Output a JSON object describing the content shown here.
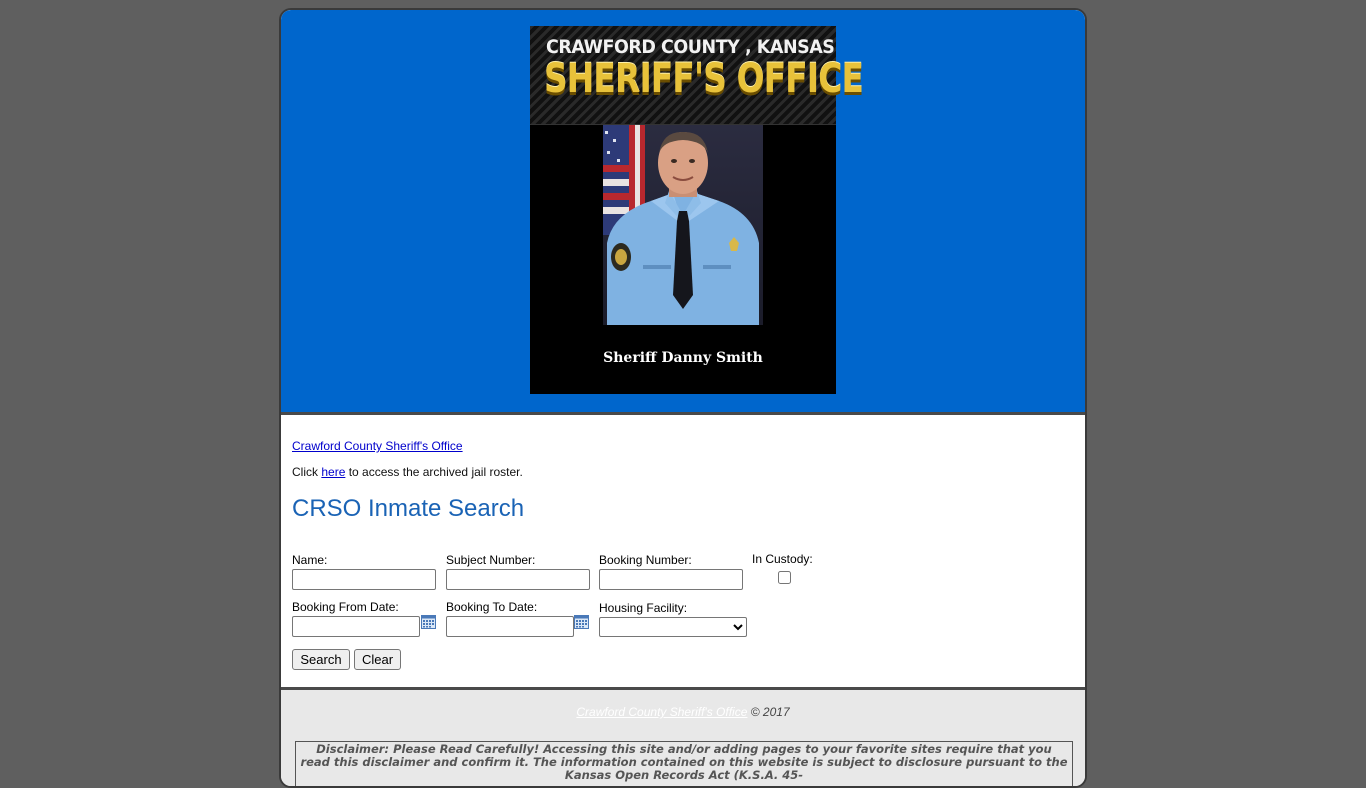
{
  "banner": {
    "logo_county": "CRAWFORD COUNTY , KANSAS",
    "logo_office": "SHERIFF'S OFFICE",
    "logo_caption": "Sheriff Danny Smith",
    "background_color": "#0066cc"
  },
  "content": {
    "top_link": "Crawford County Sheriff's Office",
    "archive_prefix": "Click ",
    "archive_link": "here",
    "archive_suffix": " to access the archived jail roster.",
    "title": "CRSO Inmate Search",
    "title_color": "#1a63b5"
  },
  "form": {
    "name_label": "Name:",
    "name_value": "",
    "subject_label": "Subject Number:",
    "subject_value": "",
    "booking_label": "Booking Number:",
    "booking_value": "",
    "custody_label": "In Custody:",
    "custody_checked": false,
    "from_label": "Booking From Date:",
    "from_value": "",
    "to_label": "Booking To Date:",
    "to_value": "",
    "housing_label": "Housing Facility:",
    "housing_selected": "",
    "calendar_icon": "calendar-icon",
    "search_button": "Search",
    "clear_button": "Clear"
  },
  "footer": {
    "copyright_link": "Crawford County Sheriff's Office",
    "copyright_suffix": " © 2017",
    "disclaimer": "Disclaimer: Please Read Carefully! Accessing this site and/or adding pages to your favorite sites require that you read this disclaimer and confirm it. The information contained on this website is subject to disclosure pursuant to the Kansas Open Records Act (K.S.A. 45-"
  }
}
